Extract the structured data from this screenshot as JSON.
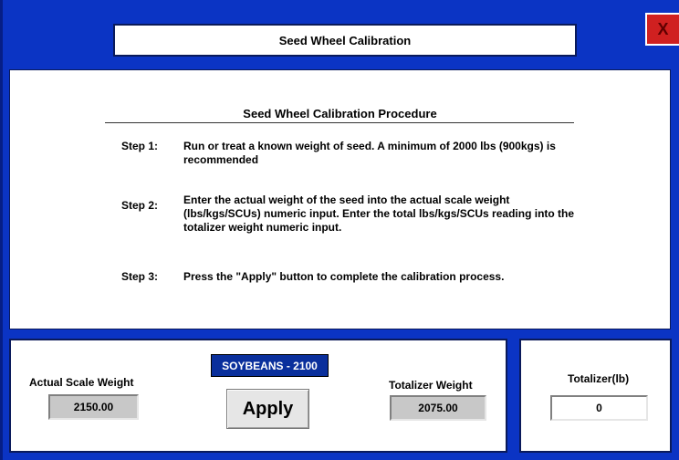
{
  "window": {
    "title": "Seed Wheel Calibration",
    "close_label": "X"
  },
  "procedure": {
    "title": "Seed Wheel Calibration Procedure",
    "steps": [
      {
        "label": "Step 1:",
        "text": "Run or treat a known weight of seed. A minimum of 2000 lbs (900kgs) is recommended"
      },
      {
        "label": "Step 2:",
        "text": "Enter the actual weight of the seed into the actual scale weight (lbs/kgs/SCUs) numeric input. Enter the total lbs/kgs/SCUs reading into the totalizer weight numeric input."
      },
      {
        "label": "Step 3:",
        "text": "Press the \"Apply\" button to complete the calibration process."
      }
    ]
  },
  "calibration": {
    "seed_product": "SOYBEANS - 2100",
    "actual_scale_weight_label": "Actual Scale Weight",
    "actual_scale_weight_value": "2150.00",
    "apply_label": "Apply",
    "totalizer_weight_label": "Totalizer Weight",
    "totalizer_weight_value": "2075.00"
  },
  "totalizer": {
    "label": "Totalizer(lb)",
    "value": "0"
  },
  "colors": {
    "background": "#0b34c4",
    "badge": "#0a2f9c",
    "close": "#d02020"
  }
}
